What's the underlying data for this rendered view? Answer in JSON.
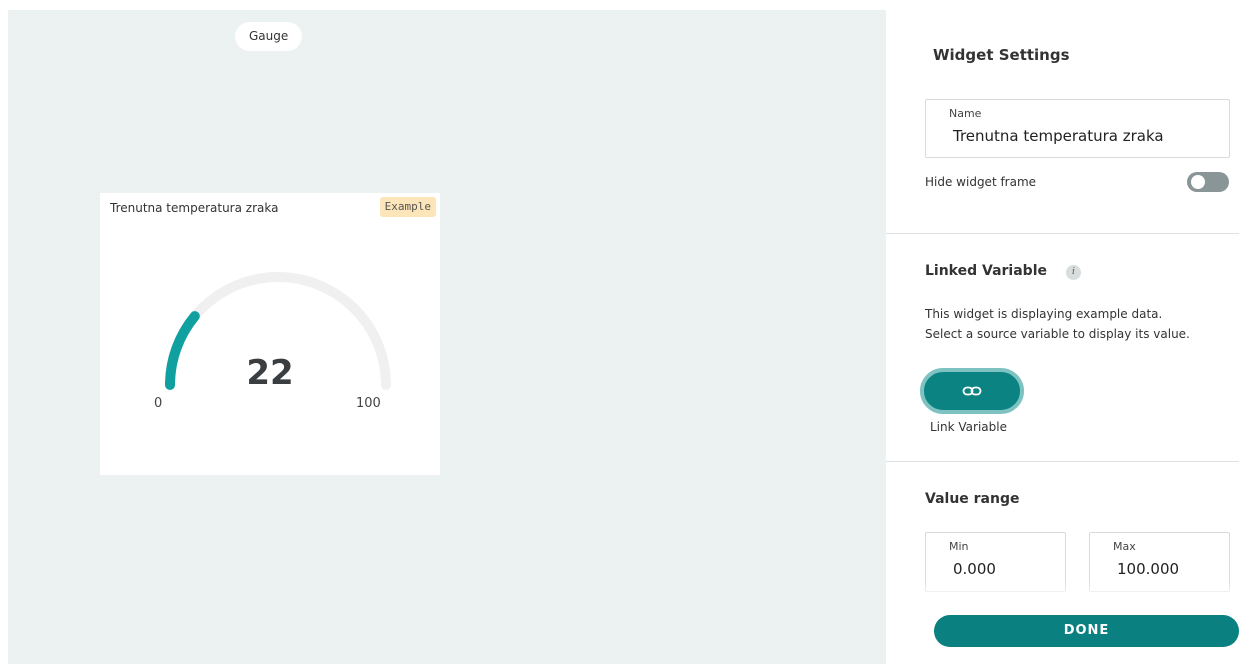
{
  "canvas": {
    "widget_type": "Gauge",
    "widget": {
      "title": "Trenutna temperatura zraka",
      "badge": "Example",
      "gauge": {
        "value": 22,
        "min_label": "0",
        "max_label": "100",
        "fraction": 0.22
      }
    }
  },
  "settings": {
    "title": "Widget Settings",
    "name_label": "Name",
    "name_value": "Trenutna temperatura zraka",
    "hide_frame_label": "Hide widget frame",
    "linked_variable": {
      "title": "Linked Variable",
      "desc_line1": "This widget is displaying example data.",
      "desc_line2": "Select a source variable to display its value.",
      "button_label": "Link Variable"
    },
    "value_range": {
      "title": "Value range",
      "min_label": "Min",
      "min_value": "0.000",
      "max_label": "Max",
      "max_value": "100.000"
    },
    "done_label": "DONE"
  },
  "colors": {
    "accent": "#0a8080",
    "track": "#f0f0f0",
    "badge": "#fce5b8"
  },
  "icons": {
    "info": "info-icon",
    "link": "link-icon"
  }
}
